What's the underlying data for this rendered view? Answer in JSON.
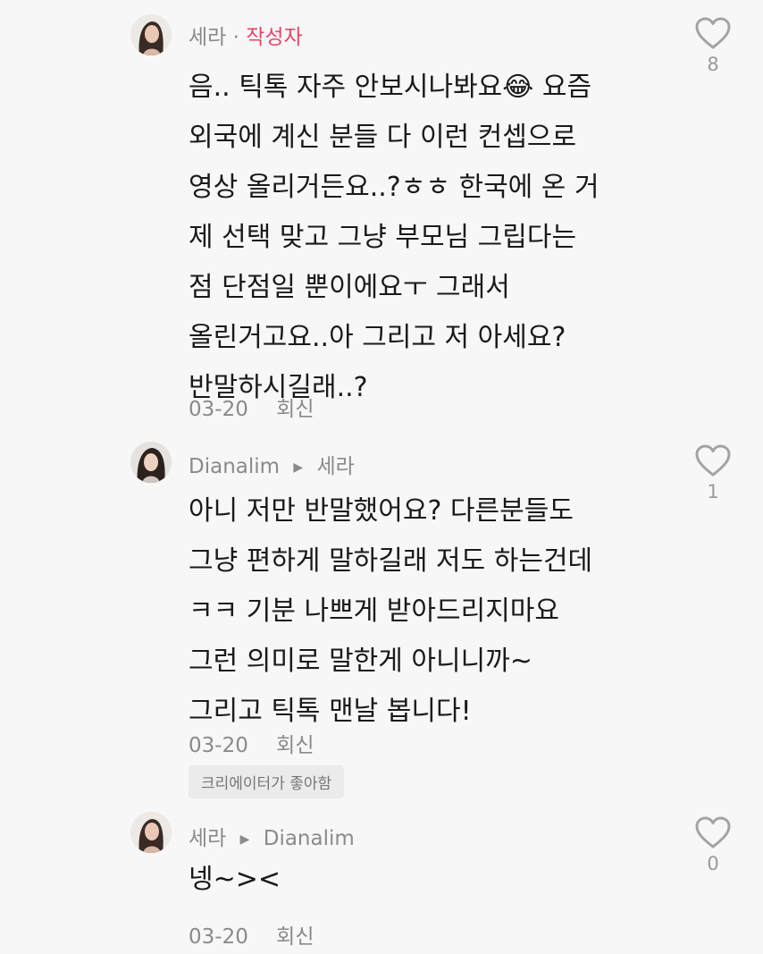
{
  "comments": [
    {
      "author": "세라",
      "separator": "·",
      "tag": "작성자",
      "lines": [
        "음.. 틱톡 자주 안보시나봐요😂 요즘",
        "외국에 계신 분들 다 이런 컨셉으로",
        "영상 올리거든요..?ㅎㅎ 한국에 온 거",
        "제 선택 맞고 그냥 부모님 그립다는",
        "점 단점일 뿐이에요ㅜ 그래서",
        "올린거고요..아 그리고 저 아세요?",
        "반말하시길래..?"
      ],
      "date": "03-20",
      "reply_label": "회신",
      "like_count": "8"
    },
    {
      "author": "Dianalim",
      "reply_to": "세라",
      "lines": [
        "아니 저만 반말했어요? 다른분들도",
        "그냥 편하게 말하길래 저도 하는건데",
        "ㅋㅋ 기분 나쁘게 받아드리지마요",
        "그런 의미로 말한게 아니니까~",
        "그리고 틱톡 맨날 봅니다!"
      ],
      "date": "03-20",
      "reply_label": "회신",
      "badge": "크리에이터가 좋아함",
      "like_count": "1"
    },
    {
      "author": "세라",
      "reply_to": "Dianalim",
      "lines": [
        "넹~><"
      ],
      "date": "03-20",
      "reply_label": "회신",
      "like_count": "0"
    }
  ],
  "icons": {
    "like": "heart-outline-icon",
    "reply_arrow": "triangle-right-icon"
  },
  "colors": {
    "author_tag": "#e8436a",
    "meta_text": "#8a8a8a",
    "background": "#f7f7f7"
  }
}
